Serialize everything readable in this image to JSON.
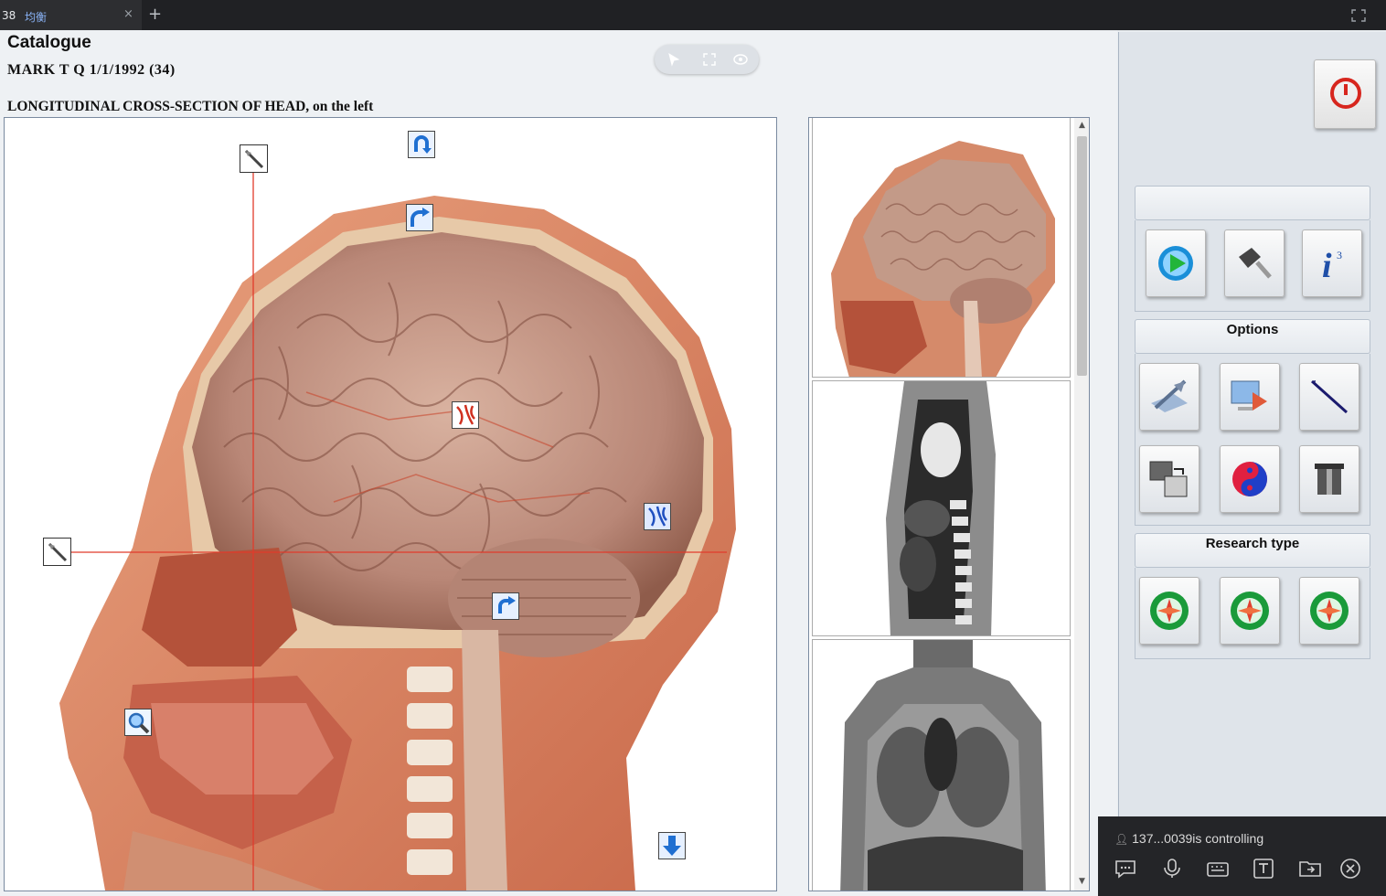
{
  "tab": {
    "number": "38",
    "title": "均衡",
    "close_glyph": "×",
    "new_tab_glyph": "+"
  },
  "app": {
    "catalogue_title": "Catalogue",
    "patient": "MARK  T  Q  1/1/1992 (34)",
    "section_title": "LONGITUDINAL CROSS-SECTION OF HEAD, on the left"
  },
  "floating_toolbar": {
    "icons": [
      "pointer-icon",
      "fullscreen-icon",
      "eye-icon"
    ]
  },
  "main_view": {
    "image": "sagittal-head-anatomy",
    "markers": [
      "scalpel-marker-vertical",
      "scalpel-marker-horizontal",
      "rotate-marker-top",
      "redo-marker",
      "vessel-marker",
      "vessel-marker-blue",
      "rotate-marker-neck",
      "magnifier-marker",
      "down-arrow-marker"
    ]
  },
  "thumbnails": [
    "head-sagittal-thumbnail",
    "spine-mri-sagittal-thumbnail",
    "torso-mri-coronal-thumbnail"
  ],
  "right_panel": {
    "group1_label": "",
    "group1_buttons": [
      "play-icon",
      "magnify-tool-icon",
      "info-icon"
    ],
    "options_label": "Options",
    "options_buttons": [
      "quill-document-icon",
      "monitor-export-icon",
      "probe-icon",
      "photo-compare-icon",
      "yin-yang-icon",
      "container-icon"
    ],
    "research_label": "Research type",
    "research_buttons": [
      "research-clock-icon-1",
      "research-clock-icon-2",
      "research-clock-icon-3"
    ]
  },
  "remote_control": {
    "status": "137...0039is controlling",
    "icons": [
      "chat-icon",
      "microphone-icon",
      "keyboard-icon",
      "text-icon",
      "folder-transfer-icon",
      "close-circle-icon"
    ]
  },
  "colors": {
    "accent_red": "#d7261e",
    "crosshair": "#e13b2b",
    "panel_bg": "#dfe4ea"
  }
}
